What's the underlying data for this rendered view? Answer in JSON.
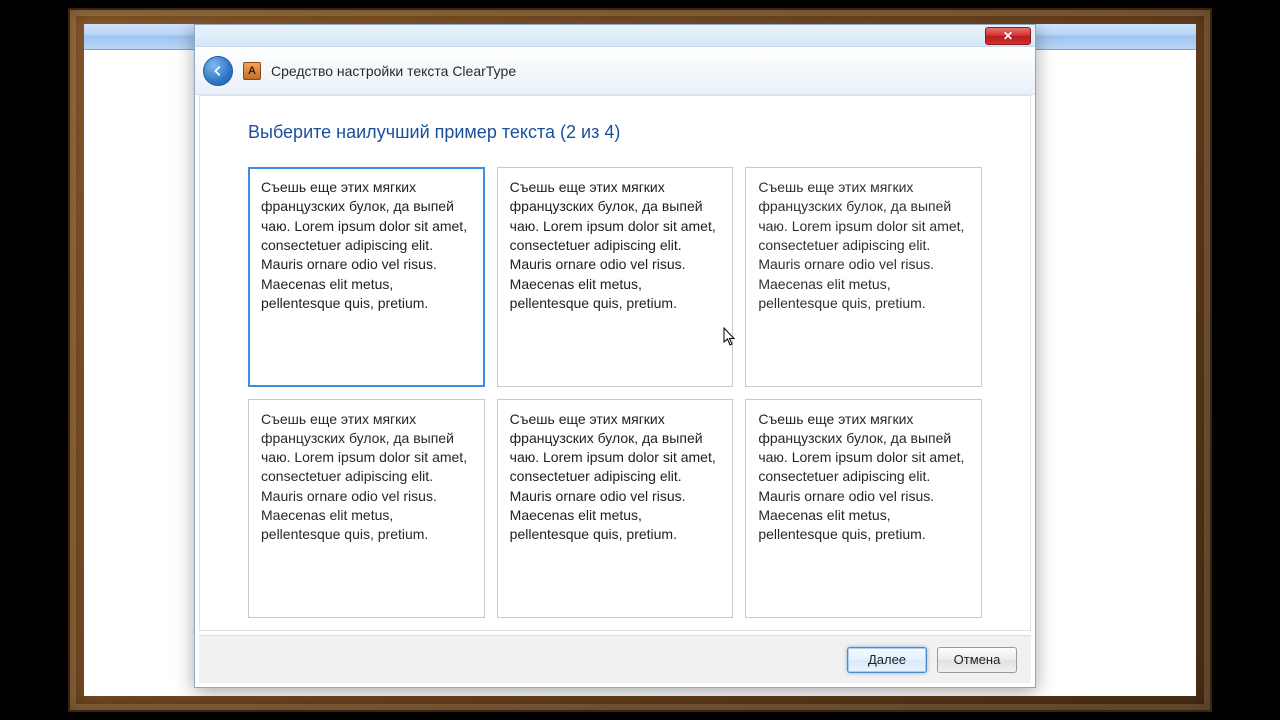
{
  "window": {
    "title": "Средство настройки текста ClearType",
    "icon_letter": "A"
  },
  "instruction": "Выберите наилучший пример текста (2 из 4)",
  "sample_text": "Съешь еще этих мягких французских булок, да выпей чаю. Lorem ipsum dolor sit amet, consectetuer adipiscing elit. Mauris ornare odio vel risus. Maecenas elit metus, pellentesque quis, pretium.",
  "samples": {
    "count": 6,
    "selected_index": 0
  },
  "buttons": {
    "next": "Далее",
    "cancel": "Отмена"
  }
}
